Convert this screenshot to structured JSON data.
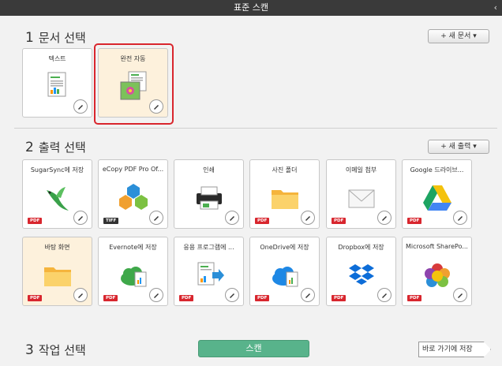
{
  "window": {
    "title": "표준 스캔",
    "back_glyph": "‹"
  },
  "section1": {
    "num": "1",
    "title": "문서 선택",
    "add_label": "+ 새 문서 ▾"
  },
  "doc_cards": [
    {
      "label": "텍스트",
      "icon": "text-document-icon"
    },
    {
      "label": "완전 자동",
      "icon": "auto-document-icon"
    }
  ],
  "section2": {
    "num": "2",
    "title": "출력 선택",
    "add_label": "+ 새 출력 ▾"
  },
  "output_cards": [
    {
      "label": "SugarSync에 저장",
      "badge": "PDF",
      "icon": "hummingbird-icon"
    },
    {
      "label": "eCopy PDF Pro Of...",
      "badge": "TIFF",
      "icon": "hexagons-icon"
    },
    {
      "label": "인쇄",
      "badge": "",
      "icon": "printer-icon"
    },
    {
      "label": "사진 폴더",
      "badge": "PDF",
      "icon": "folder-icon"
    },
    {
      "label": "이메일 첨부",
      "badge": "PDF",
      "icon": "envelope-icon"
    },
    {
      "label": "Google 드라이브...",
      "badge": "PDF",
      "icon": "google-drive-icon"
    },
    {
      "label": "바탕 화면",
      "badge": "PDF",
      "icon": "folder-icon"
    },
    {
      "label": "Evernote에 저장",
      "badge": "PDF",
      "icon": "cloud-doc-icon"
    },
    {
      "label": "응용 프로그램에 ...",
      "badge": "PDF",
      "icon": "doc-arrow-icon"
    },
    {
      "label": "OneDrive에 저장",
      "badge": "PDF",
      "icon": "cloud-doc-icon"
    },
    {
      "label": "Dropbox에 저장",
      "badge": "PDF",
      "icon": "dropbox-icon"
    },
    {
      "label": "Microsoft SharePo...",
      "badge": "PDF",
      "icon": "sharepoint-icon"
    }
  ],
  "section3": {
    "num": "3",
    "title": "작업 선택"
  },
  "actions": {
    "scan_label": "스캔",
    "shortcut_label": "바로 가기에 저장"
  },
  "colors": {
    "accent": "#58b38b",
    "selected_border": "#d9262d",
    "pdf_badge": "#d8262e"
  }
}
